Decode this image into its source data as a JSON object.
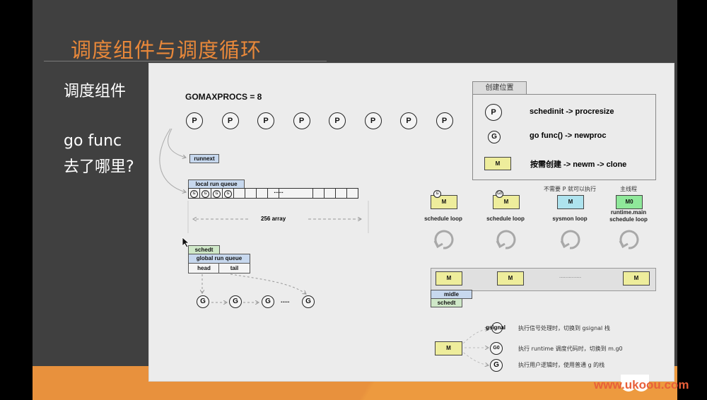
{
  "slide": {
    "title": "调度组件与调度循环",
    "side": {
      "heading": "调度组件",
      "question_line1": "go func",
      "question_line2": "去了哪里?"
    }
  },
  "diagram": {
    "gomaxprocs_label": "GOMAXPROCS = 8",
    "p_label": "P",
    "p_count": 8,
    "runnext_label": "runnext",
    "local_run_queue": {
      "label": "local run queue",
      "g_marker": "G",
      "filled_slots": 4,
      "ellipsis": "......",
      "array_label": "256 array"
    },
    "global_run_queue": {
      "schedt_label": "schedt",
      "label": "global run queue",
      "head_label": "head",
      "tail_label": "tail",
      "g_label": "G",
      "ellipsis": "....."
    },
    "legend": {
      "tab_label": "创建位置",
      "items": [
        {
          "icon": "P",
          "text": "schedinit -> procresize"
        },
        {
          "icon": "G",
          "text": "go func() -> newproc"
        },
        {
          "icon": "M",
          "text": "按需创建 ->  newm ->  clone"
        }
      ]
    },
    "loops": [
      {
        "badge": "G",
        "box": "M",
        "note": "",
        "label": "schedule loop",
        "color": "#eeed9c"
      },
      {
        "badge": "G0",
        "box": "M",
        "note": "",
        "label": "schedule loop",
        "color": "#eeed9c"
      },
      {
        "badge": "",
        "box": "M",
        "note": "不需要 P 就可以执行",
        "label": "sysmon loop",
        "color": "#aee3ee"
      },
      {
        "badge": "",
        "box": "M0",
        "note": "主线程",
        "label": "runtime.main\nschedule loop",
        "color": "#8fe89a"
      }
    ],
    "m_list": {
      "m_label": "M",
      "dots": "..............",
      "midle_label": "midle",
      "schedt_label": "schedt"
    },
    "m_stacks": {
      "m_label": "M",
      "items": [
        {
          "icon": "gsignal",
          "text": "执行信号处理时，切换到 gsignal 栈"
        },
        {
          "icon": "G0",
          "text": "执行 runtime 调度代码时，切换到 m.g0"
        },
        {
          "icon": "G",
          "text": "执行用户逻辑时，使用普通 g 的栈"
        }
      ]
    }
  },
  "watermark": "www.ukoou.com",
  "colors": {
    "title": "#e8883a",
    "footer": "#e8913d",
    "m_box": "#eeed9c",
    "tag_blue": "#c7d8ee",
    "tag_green": "#cfe8c8"
  }
}
